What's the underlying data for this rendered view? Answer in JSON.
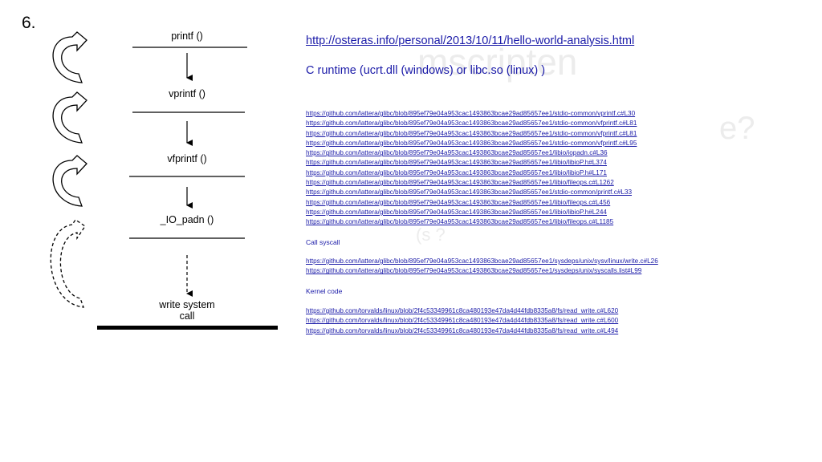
{
  "slide_number": "6.",
  "watermarks": [
    "mscripten",
    "e?",
    "(s ?"
  ],
  "diagram": {
    "steps": [
      "printf ()",
      "vprintf ()",
      "vfprintf ()",
      "_IO_padn ()"
    ],
    "final": [
      "write system",
      "call"
    ]
  },
  "main_link": "http://osteras.info/personal/2013/10/11/hello-world-analysis.html",
  "runtime_text": "C runtime (ucrt.dll (windows) or libc.so (linux) )",
  "glibc_links": [
    "https://github.com/lattera/glibc/blob/895ef79e04a953cac1493863bcae29ad85657ee1/stdio-common/vprintf.c#L30",
    "https://github.com/lattera/glibc/blob/895ef79e04a953cac1493863bcae29ad85657ee1/stdio-common/vfprintf.c#L81",
    "https://github.com/lattera/glibc/blob/895ef79e04a953cac1493863bcae29ad85657ee1/stdio-common/vfprintf.c#L81",
    "https://github.com/lattera/glibc/blob/895ef79e04a953cac1493863bcae29ad85657ee1/stdio-common/vfprintf.c#L95",
    "https://github.com/lattera/glibc/blob/895ef79e04a953cac1493863bcae29ad85657ee1/libio/iopadn.c#L36",
    "https://github.com/lattera/glibc/blob/895ef79e04a953cac1493863bcae29ad85657ee1/libio/libioP.h#L374",
    "https://github.com/lattera/glibc/blob/895ef79e04a953cac1493863bcae29ad85657ee1/libio/libioP.h#L171",
    "https://github.com/lattera/glibc/blob/895ef79e04a953cac1493863bcae29ad85657ee1/libio/fileops.c#L1262",
    "https://github.com/lattera/glibc/blob/895ef79e04a953cac1493863bcae29ad85657ee1/stdio-common/printf.c#L33",
    "https://github.com/lattera/glibc/blob/895ef79e04a953cac1493863bcae29ad85657ee1/libio/fileops.c#L456",
    "https://github.com/lattera/glibc/blob/895ef79e04a953cac1493863bcae29ad85657ee1/libio/libioP.h#L244",
    "https://github.com/lattera/glibc/blob/895ef79e04a953cac1493863bcae29ad85657ee1/libio/fileops.c#L1185"
  ],
  "syscall_label": "Call syscall",
  "syscall_links": [
    "https://github.com/lattera/glibc/blob/895ef79e04a953cac1493863bcae29ad85657ee1/sysdeps/unix/sysv/linux/write.c#L26",
    "https://github.com/lattera/glibc/blob/895ef79e04a953cac1493863bcae29ad85657ee1/sysdeps/unix/syscalls.list#L99"
  ],
  "kernel_label": "Kernel code",
  "kernel_links": [
    "https://github.com/torvalds/linux/blob/2f4c53349961c8ca480193e47da4d44fdb8335a8/fs/read_write.c#L620",
    "https://github.com/torvalds/linux/blob/2f4c53349961c8ca480193e47da4d44fdb8335a8/fs/read_write.c#L600",
    "https://github.com/torvalds/linux/blob/2f4c53349961c8ca480193e47da4d44fdb8335a8/fs/read_write.c#L494"
  ]
}
